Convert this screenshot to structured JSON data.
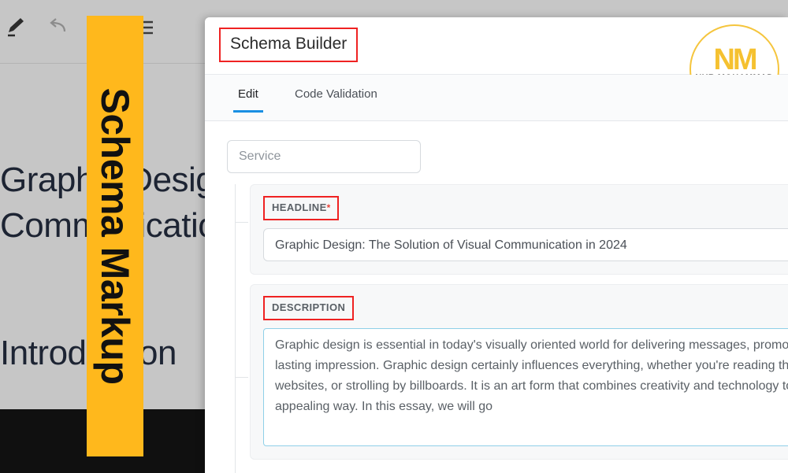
{
  "background": {
    "toolbar_icons": [
      "pencil-icon",
      "undo-icon",
      "redo-icon",
      "align-list-icon"
    ],
    "doc_title_line1": "Graphic Design:",
    "doc_title_line2": "Communication",
    "doc_section": "Introduction"
  },
  "banner": {
    "text": "Schema Markup",
    "color": "#ffb81c"
  },
  "logo": {
    "mark": "NM",
    "name": "NUR MOHAMMAD",
    "color": "#f5c130"
  },
  "panel": {
    "title": "Schema Builder",
    "highlight_color": "#ef2222"
  },
  "tabs": [
    {
      "label": "Edit",
      "active": true
    },
    {
      "label": "Code Validation",
      "active": false
    }
  ],
  "tab_accent": "#1a8fe3",
  "service": {
    "value": "Service",
    "placeholder": "Service"
  },
  "fields": [
    {
      "label": "HEADLINE",
      "required": true,
      "required_mark": "*",
      "value": "Graphic Design: The Solution of Visual Communication in 2024"
    },
    {
      "label": "DESCRIPTION",
      "required": false,
      "required_mark": "",
      "value": "Graphic design is essential in today's visually oriented world for delivering messages, promoting businesses, and making a lasting impression. Graphic design certainly influences everything, whether you're reading through social media, perusing websites, or strolling by billboards. It is an art form that combines creativity and technology to deliver concepts in a visually appealing way. In this essay, we will go"
    }
  ]
}
